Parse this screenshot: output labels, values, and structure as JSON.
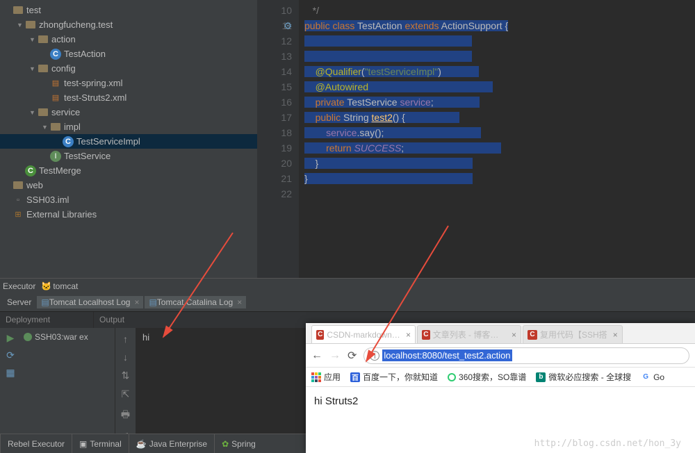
{
  "tree": {
    "items": [
      {
        "indent": 0,
        "arrow": "",
        "icon": "folder",
        "label": "test"
      },
      {
        "indent": 1,
        "arrow": "▼",
        "icon": "folder",
        "label": "zhongfucheng.test"
      },
      {
        "indent": 2,
        "arrow": "▼",
        "icon": "folder",
        "label": "action"
      },
      {
        "indent": 3,
        "arrow": "",
        "icon": "class-blue",
        "label": "TestAction"
      },
      {
        "indent": 2,
        "arrow": "▼",
        "icon": "folder",
        "label": "config"
      },
      {
        "indent": 3,
        "arrow": "",
        "icon": "xml",
        "label": "test-spring.xml"
      },
      {
        "indent": 3,
        "arrow": "",
        "icon": "xml",
        "label": "test-Struts2.xml"
      },
      {
        "indent": 2,
        "arrow": "▼",
        "icon": "folder",
        "label": "service"
      },
      {
        "indent": 3,
        "arrow": "▼",
        "icon": "folder",
        "label": "impl"
      },
      {
        "indent": 4,
        "arrow": "",
        "icon": "class-blue",
        "label": "TestServiceImpl",
        "selected": true
      },
      {
        "indent": 3,
        "arrow": "",
        "icon": "interface",
        "label": "TestService"
      },
      {
        "indent": 1,
        "arrow": "",
        "icon": "class",
        "label": "TestMerge"
      },
      {
        "indent": 0,
        "arrow": "",
        "icon": "folder",
        "label": "web"
      },
      {
        "indent": 0,
        "arrow": "",
        "icon": "file",
        "label": "SSH03.iml"
      },
      {
        "indent": 0,
        "arrow": "",
        "icon": "lib",
        "label": "External Libraries"
      }
    ]
  },
  "editor": {
    "line_start": 10,
    "lines": [
      {
        "n": 10,
        "html": "   <span class='comment'>*/</span>"
      },
      {
        "n": 11,
        "html": "<span class='sel'><span class='kw'>public</span> <span class='kw'>class</span> TestAction <span class='kw'>extends</span> ActionSupport {</span>"
      },
      {
        "n": 12,
        "html": "<span class='sel'>                                                              </span>"
      },
      {
        "n": 13,
        "html": "<span class='sel'>                                                              </span>"
      },
      {
        "n": 14,
        "html": "<span class='sel'>    <span class='anno'>@Qualifier</span>(<span class='str'>\"testServiceImpl\"</span>)              </span>"
      },
      {
        "n": 15,
        "html": "<span class='sel'>    <span class='anno'>@Autowired</span>                                              </span>"
      },
      {
        "n": 16,
        "html": "<span class='sel'>    <span class='kw'>private</span> TestService <span class='ident'>service</span>;                 </span>"
      },
      {
        "n": 17,
        "html": "<span class='sel'>    <span class='kw'>public</span> String <span class='meth underline'>test2</span>() {                    </span>"
      },
      {
        "n": 18,
        "html": "<span class='sel'>        <span class='ident'>service</span>.say();                                    </span>"
      },
      {
        "n": 19,
        "html": "<span class='sel'>        <span class='kw'>return</span> <span class='ident italic'>SUCCESS</span>;                                    </span>"
      },
      {
        "n": 20,
        "html": "<span class='sel'>    }                                                         </span>"
      },
      {
        "n": 21,
        "html": "<span class='sel'>}                                                             </span>"
      },
      {
        "n": 22,
        "html": ""
      }
    ]
  },
  "exec": {
    "label": "Executor",
    "tomcat": "tomcat"
  },
  "tabs": {
    "server": "Server",
    "t1": "Tomcat Localhost Log",
    "t2": "Tomcat Catalina Log"
  },
  "output": {
    "deployment": "Deployment",
    "output": "Output",
    "dep_item": "SSH03:war ex",
    "console": "hi"
  },
  "status": {
    "rebel": "Rebel Executor",
    "terminal": "Terminal",
    "java": "Java Enterprise",
    "spring": "Spring"
  },
  "browser": {
    "tabs": [
      {
        "favicon_bg": "#c0392b",
        "favicon_text": "C",
        "title": "CSDN-markdown编辑器"
      },
      {
        "favicon_bg": "#c0392b",
        "favicon_text": "C",
        "title": "文章列表 - 博客频道 - C"
      },
      {
        "favicon_bg": "#c0392b",
        "favicon_text": "C",
        "title": "复用代码【SSH搭"
      }
    ],
    "url": "localhost:8080/test_test2.action",
    "bookmarks": {
      "apps": "应用",
      "baidu": "百度一下，你就知道",
      "so360": "360搜索，SO靠谱",
      "bing": "微软必应搜索 - 全球搜",
      "google": "Go"
    },
    "content": "hi Struts2",
    "watermark": "http://blog.csdn.net/hon_3y"
  }
}
